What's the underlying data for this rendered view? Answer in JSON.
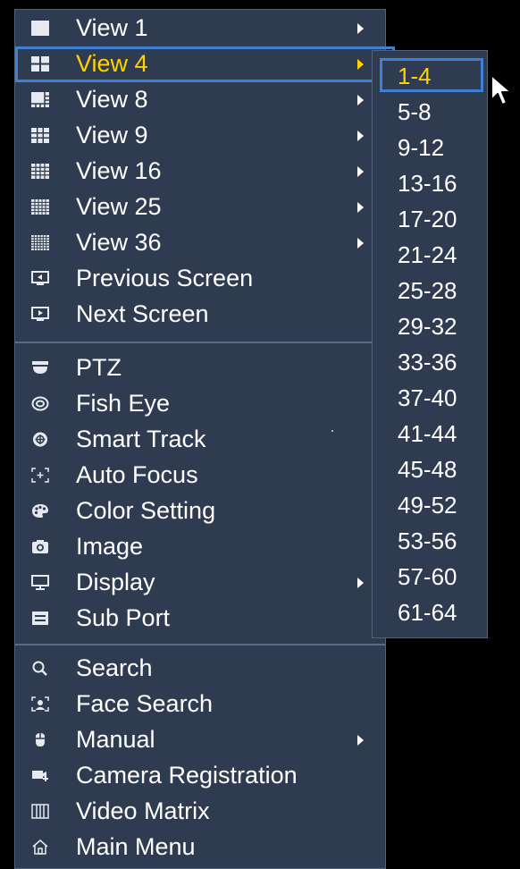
{
  "colors": {
    "background": "#2f3b50",
    "text": "#ffffff",
    "active_text": "#ffd200",
    "highlight": "#3f7fd6"
  },
  "menu": {
    "items": [
      {
        "label": "View 1",
        "icon": "view-1-icon",
        "arrow": true
      },
      {
        "label": "View 4",
        "icon": "view-4-icon",
        "arrow": true,
        "active": true
      },
      {
        "label": "View 8",
        "icon": "view-8-icon",
        "arrow": true
      },
      {
        "label": "View 9",
        "icon": "view-9-icon",
        "arrow": true
      },
      {
        "label": "View 16",
        "icon": "view-16-icon",
        "arrow": true
      },
      {
        "label": "View 25",
        "icon": "view-25-icon",
        "arrow": true
      },
      {
        "label": "View 36",
        "icon": "view-36-icon",
        "arrow": true
      },
      {
        "label": "Previous Screen",
        "icon": "previous-screen-icon"
      },
      {
        "label": "Next Screen",
        "icon": "next-screen-icon"
      },
      {
        "label": "PTZ",
        "icon": "ptz-icon"
      },
      {
        "label": "Fish Eye",
        "icon": "fish-eye-icon"
      },
      {
        "label": "Smart Track",
        "icon": "smart-track-icon"
      },
      {
        "label": "Auto Focus",
        "icon": "auto-focus-icon"
      },
      {
        "label": "Color Setting",
        "icon": "color-setting-icon"
      },
      {
        "label": "Image",
        "icon": "camera-icon"
      },
      {
        "label": "Display",
        "icon": "monitor-icon",
        "arrow": true
      },
      {
        "label": "Sub Port",
        "icon": "sub-port-icon"
      },
      {
        "label": "Search",
        "icon": "search-icon"
      },
      {
        "label": "Face Search",
        "icon": "face-search-icon"
      },
      {
        "label": "Manual",
        "icon": "manual-icon",
        "arrow": true
      },
      {
        "label": "Camera Registration",
        "icon": "camera-registration-icon"
      },
      {
        "label": "Video Matrix",
        "icon": "video-matrix-icon"
      },
      {
        "label": "Main Menu",
        "icon": "home-icon"
      }
    ]
  },
  "submenu": {
    "items": [
      "1-4",
      "5-8",
      "9-12",
      "13-16",
      "17-20",
      "21-24",
      "25-28",
      "29-32",
      "33-36",
      "37-40",
      "41-44",
      "45-48",
      "49-52",
      "53-56",
      "57-60",
      "61-64"
    ],
    "active_index": 0
  }
}
